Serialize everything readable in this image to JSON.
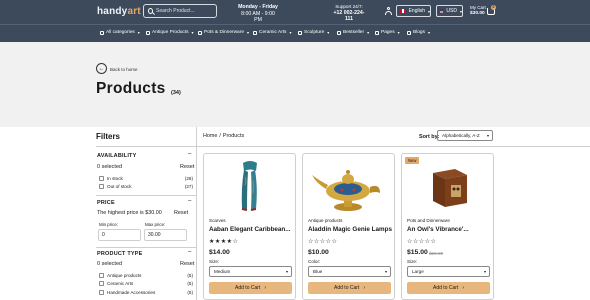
{
  "header": {
    "logo_main": "handy",
    "logo_accent": "art",
    "search_placeholder": "Search Product...",
    "hours_title": "Monday - Friday",
    "hours_time": "8:00 AM - 9:00 PM",
    "support_title": "Support 24/7:",
    "support_phone": "+12 002-224-111",
    "language": "English",
    "currency": "USD",
    "cart_label": "My Cart",
    "cart_total": "$30.00",
    "cart_count": "0"
  },
  "nav": {
    "items": [
      "All categories",
      "Antique Products",
      "Pots & Dinnerware",
      "Ceramic Arts",
      "Sculpture",
      "Bestseller",
      "Pages",
      "Blogs"
    ]
  },
  "hero": {
    "back_label": "Back to home",
    "title": "Products",
    "count": "(34)"
  },
  "filters": {
    "title": "Filters",
    "availability": {
      "heading": "AVAILABILITY",
      "toggle": "–",
      "selected": "0 selected",
      "reset": "Reset",
      "options": [
        {
          "label": "In stock",
          "count": "(28)"
        },
        {
          "label": "Out of stock",
          "count": "(27)"
        }
      ]
    },
    "price": {
      "heading": "PRICE",
      "toggle": "–",
      "note": "The highest price is $30.00",
      "reset": "Reset",
      "min_label": "Min price:",
      "min_value": "0",
      "max_label": "Max price:",
      "max_value": "30.00"
    },
    "product_type": {
      "heading": "PRODUCT TYPE",
      "toggle": "–",
      "selected": "0 selected",
      "reset": "Reset",
      "options": [
        {
          "label": "Antique products",
          "count": "(5)"
        },
        {
          "label": "Ceramic Arts",
          "count": "(5)"
        },
        {
          "label": "Handmade Accessories",
          "count": "(5)"
        }
      ]
    }
  },
  "main": {
    "breadcrumb_home": "Home",
    "breadcrumb_sep": "/",
    "breadcrumb_current": "Products",
    "sort_label": "Sort by:",
    "sort_value": "Alphabetically, A-Z"
  },
  "products": [
    {
      "badge": "",
      "category": "Scarves",
      "name": "Aaban Elegant Caribbean...",
      "stars": "★★★★☆",
      "price": "$14.00",
      "old_price": "",
      "option_label": "Size:",
      "option_value": "Medium",
      "add_label": "Add to Cart"
    },
    {
      "badge": "",
      "category": "Antique products",
      "name": "Aladdin Magic Genie Lamps",
      "stars": "☆☆☆☆☆",
      "price": "$10.00",
      "old_price": "",
      "option_label": "Color:",
      "option_value": "Blue",
      "add_label": "Add to Cart"
    },
    {
      "badge": "New",
      "category": "Pots and Dinnerware",
      "name": "An Owl's Vibrance'...",
      "stars": "☆☆☆☆☆",
      "price": "$15.00",
      "old_price": "$25.00",
      "option_label": "Size:",
      "option_value": "Large",
      "add_label": "Add to Cart"
    }
  ],
  "colors": {
    "header_bg": "#3d4a5c",
    "accent": "#e3a96a",
    "button": "#e7b77e",
    "hero_bg": "#f1f1f1"
  }
}
